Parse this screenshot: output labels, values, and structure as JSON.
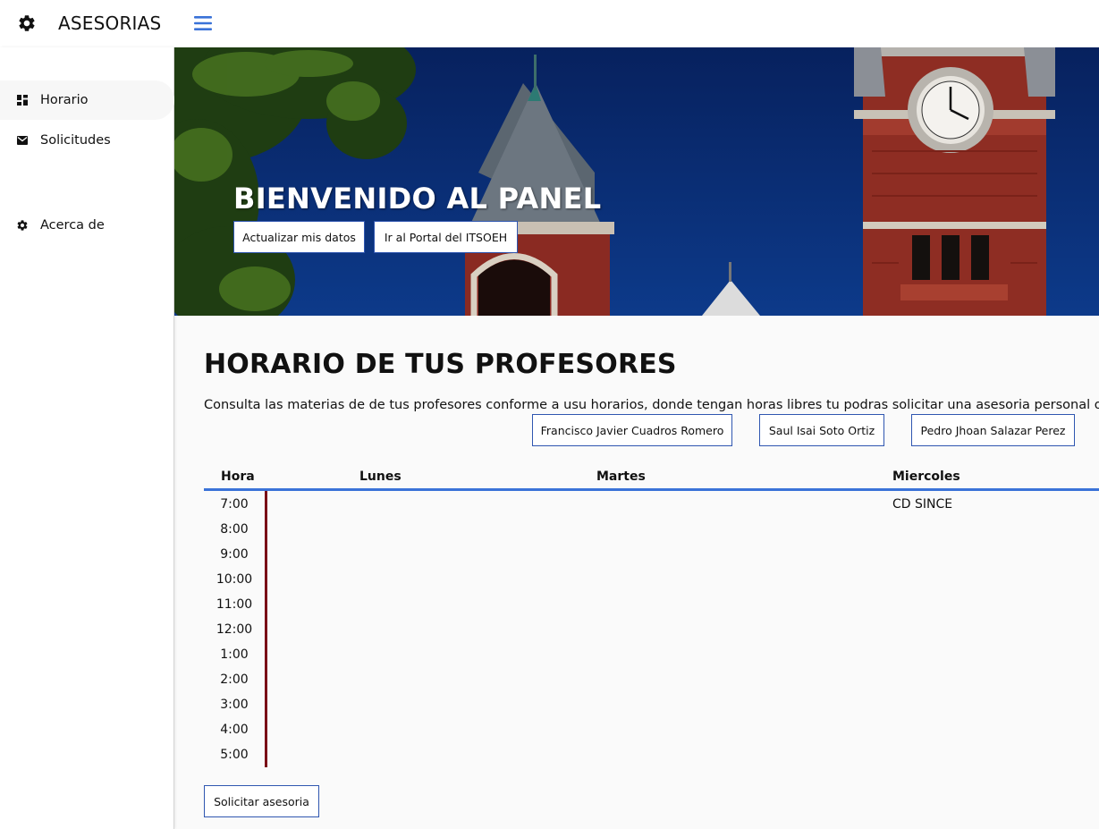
{
  "app": {
    "title": "ASESORIAS",
    "brand_icon": "gear-icon",
    "menu_icon": "hamburger-menu-icon",
    "accent_color": "#3a72d8"
  },
  "sidebar": {
    "items": [
      {
        "label": "Horario",
        "icon": "dashboard-icon",
        "active": true
      },
      {
        "label": "Solicitudes",
        "icon": "mail-icon",
        "active": false
      },
      {
        "label": "Acerca de",
        "icon": "gear-icon",
        "active": false
      }
    ]
  },
  "hero": {
    "title": "BIENVENIDO AL PANEL",
    "buttons": [
      "Actualizar mis datos",
      "Ir al Portal del ITSOEH"
    ]
  },
  "schedule": {
    "title": "HORARIO DE TUS PROFESORES",
    "description": "Consulta las materias de de tus profesores conforme a usu horarios, donde tengan horas libres tu podras solicitar una asesoria personal o grupal",
    "teachers": [
      "Francisco Javier Cuadros Romero",
      "Saul Isai Soto Ortiz",
      "Pedro Jhoan Salazar Perez"
    ],
    "columns": [
      "Hora",
      "Lunes",
      "Martes",
      "Miercoles"
    ],
    "hours": [
      "7:00",
      "8:00",
      "9:00",
      "10:00",
      "11:00",
      "12:00",
      "1:00",
      "2:00",
      "3:00",
      "4:00",
      "5:00"
    ],
    "entries": {
      "miercoles_7": "CD SINCE"
    },
    "request_button": "Solicitar asesoria",
    "timeline_color": "#7a0e16"
  }
}
